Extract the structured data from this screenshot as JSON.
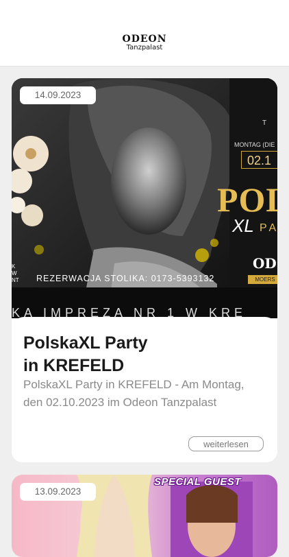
{
  "header": {
    "logo_word": "ODEON",
    "logo_sub": "Tanzpalast"
  },
  "posts": [
    {
      "date": "14.09.2023",
      "title": "PolskaXL Party\nin KREFELD",
      "excerpt": "PolskaXL Party in KREFELD - Am Montag, den 02.10.2023 im Odeon Tanzpalast",
      "read_more": "weiterlesen",
      "poster": {
        "day_label": "MONTAG (DIE",
        "date_fragment": "02.1",
        "brand_big": "POL",
        "brand_xl": "XL",
        "brand_pa": "PA",
        "phone": "REZERWACJA STOLIKA: 0173-5393132",
        "venue_fragment": "OD",
        "venue_city": "MOERS",
        "ticker": "KA IMPREZA NR 1 W KRE",
        "top_letter": "T",
        "left_lines": [
          "K",
          "W",
          "NT"
        ]
      }
    },
    {
      "date": "13.09.2023",
      "poster": {
        "guest_label": "SPECIAL GUEST"
      }
    }
  ],
  "colors": {
    "background": "#efefef",
    "card": "#ffffff",
    "gold": "#e6bd54",
    "text_dark": "#1a1a1a",
    "text_muted": "#8a8a8a"
  }
}
